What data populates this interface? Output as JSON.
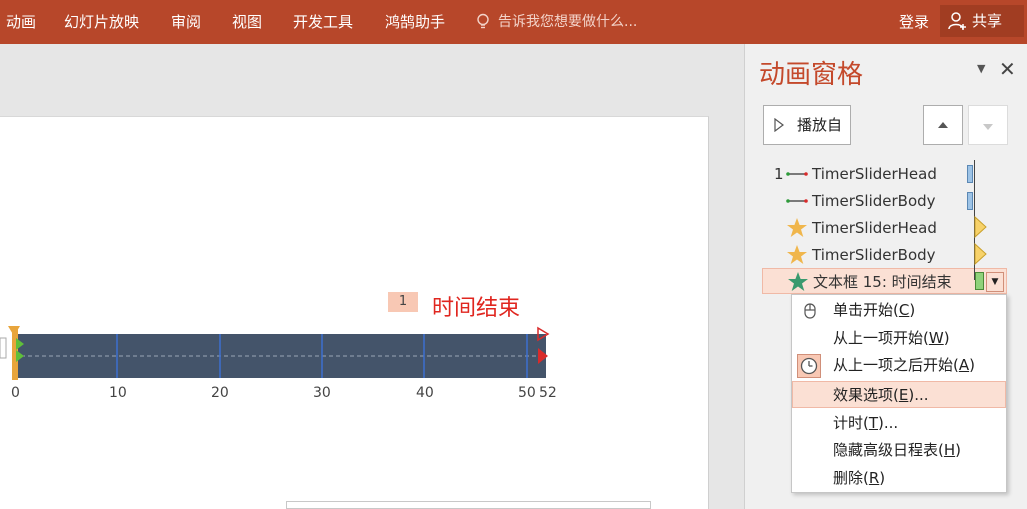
{
  "ribbon": {
    "tabs": [
      "动画",
      "幻灯片放映",
      "审阅",
      "视图",
      "开发工具",
      "鸿鹄助手"
    ],
    "tell_me": "告诉我您想要做什么...",
    "login": "登录",
    "share": "共享"
  },
  "slide": {
    "marker_number": "1",
    "caption": "时间结束",
    "ticks": [
      "0",
      "10",
      "20",
      "30",
      "40",
      "50",
      "52"
    ]
  },
  "pane": {
    "title": "动画窗格",
    "play_button": "播放自",
    "items": [
      {
        "number": "1",
        "name": "TimerSliderHead",
        "icon": "motion-path-icon"
      },
      {
        "number": "",
        "name": "TimerSliderBody",
        "icon": "motion-path-icon"
      },
      {
        "number": "",
        "name": "TimerSliderHead",
        "icon": "star-icon"
      },
      {
        "number": "",
        "name": "TimerSliderBody",
        "icon": "star-icon"
      },
      {
        "number": "",
        "name": "文本框 15: 时间结束",
        "icon": "green-star-icon"
      }
    ]
  },
  "context_menu": {
    "items": [
      {
        "label": "单击开始(C)",
        "text": "单击开始(",
        "key": "C",
        "tail": ")"
      },
      {
        "label": "从上一项开始(W)",
        "text": "从上一项开始(",
        "key": "W",
        "tail": ")"
      },
      {
        "label": "从上一项之后开始(A)",
        "text": "从上一项之后开始(",
        "key": "A",
        "tail": ")"
      },
      {
        "label": "效果选项(E)...",
        "text": "效果选项(",
        "key": "E",
        "tail": ")..."
      },
      {
        "label": "计时(T)...",
        "text": "计时(",
        "key": "T",
        "tail": ")..."
      },
      {
        "label": "隐藏高级日程表(H)",
        "text": "隐藏高级日程表(",
        "key": "H",
        "tail": ")"
      },
      {
        "label": "删除(R)",
        "text": "删除(",
        "key": "R",
        "tail": ")"
      }
    ]
  },
  "colors": {
    "ribbon": "#b7472a",
    "accent": "#c4492b",
    "timer_bar": "#44546a",
    "caption": "#e0261f",
    "highlight": "#fbe0d4"
  }
}
